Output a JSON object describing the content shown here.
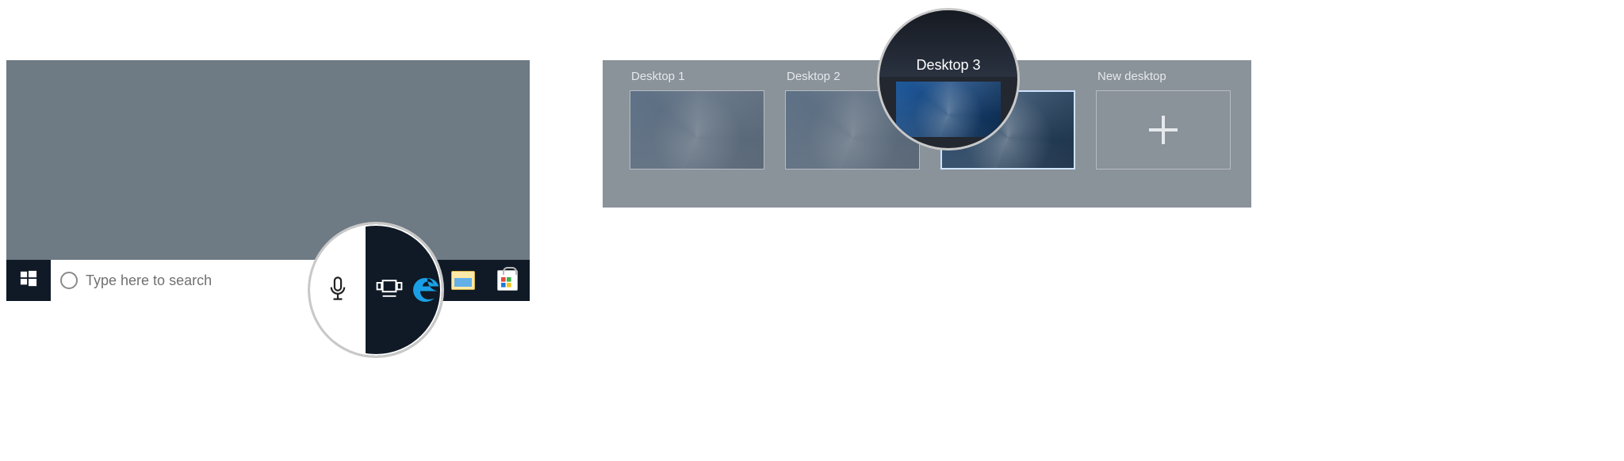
{
  "left": {
    "search_placeholder": "Type here to search",
    "icons": {
      "start": "start-icon",
      "cortana": "cortana-ring-icon",
      "mic": "microphone-icon",
      "taskview": "task-view-icon",
      "edge": "edge-icon",
      "explorer": "file-explorer-icon",
      "store": "microsoft-store-icon"
    }
  },
  "right": {
    "desktops": [
      {
        "label": "Desktop 1",
        "selected": false
      },
      {
        "label": "Desktop 2",
        "selected": false
      },
      {
        "label": "Desktop 3",
        "selected": true
      }
    ],
    "new_desktop_label": "New desktop"
  },
  "magnifier_right_label": "Desktop 3"
}
